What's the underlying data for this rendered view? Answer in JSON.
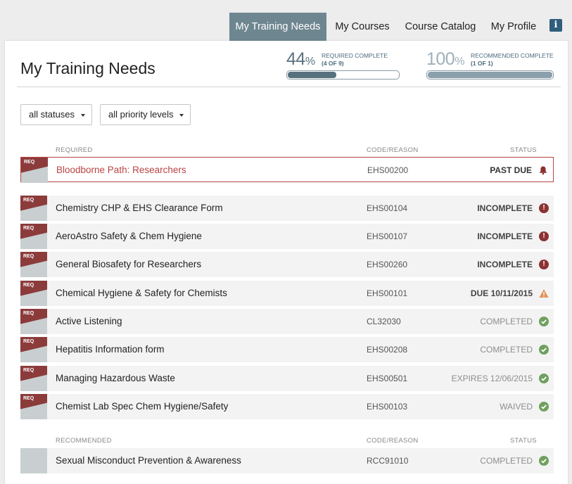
{
  "nav": {
    "tabs": [
      {
        "label": "My Training Needs",
        "active": true
      },
      {
        "label": "My Courses"
      },
      {
        "label": "Course Catalog"
      },
      {
        "label": "My Profile"
      }
    ],
    "info_icon": "info-icon"
  },
  "header": {
    "title": "My Training Needs",
    "required": {
      "pct": "44",
      "unit": "%",
      "label": "REQUIRED COMPLETE",
      "sub": "(4 OF 9)",
      "fill_fraction": 0.44
    },
    "recommended": {
      "pct": "100",
      "unit": "%",
      "label": "RECOMMENDED COMPLETE",
      "sub": "(1 OF 1)",
      "fill_fraction": 1.0
    }
  },
  "filters": {
    "status": "all statuses",
    "priority": "all priority levels"
  },
  "required_section": {
    "col_name": "REQUIRED",
    "col_code": "CODE/REASON",
    "col_status": "STATUS",
    "tag_text": "REQ",
    "rows": [
      {
        "name": "Bloodborne Path: Researchers",
        "code": "EHS00200",
        "status": "PAST DUE",
        "icon": "bell-icon"
      },
      {
        "name": "Chemistry CHP & EHS Clearance Form",
        "code": "EHS00104",
        "status": "INCOMPLETE",
        "icon": "exclamation-circle-icon"
      },
      {
        "name": "AeroAstro Safety & Chem Hygiene",
        "code": "EHS00107",
        "status": "INCOMPLETE",
        "icon": "exclamation-circle-icon"
      },
      {
        "name": "General Biosafety for Researchers",
        "code": "EHS00260",
        "status": "INCOMPLETE",
        "icon": "exclamation-circle-icon"
      },
      {
        "name": "Chemical Hygiene & Safety for Chemists",
        "code": "EHS00101",
        "status": "DUE 10/11/2015",
        "icon": "warning-triangle-icon"
      },
      {
        "name": "Active Listening",
        "code": "CL32030",
        "status": "COMPLETED",
        "icon": "check-circle-icon"
      },
      {
        "name": "Hepatitis Information form",
        "code": "EHS00208",
        "status": "COMPLETED",
        "icon": "check-circle-icon"
      },
      {
        "name": "Managing Hazardous Waste",
        "code": "EHS00501",
        "status": "EXPIRES 12/06/2015",
        "icon": "check-circle-icon"
      },
      {
        "name": "Chemist Lab Spec Chem Hygiene/Safety",
        "code": "EHS00103",
        "status": "WAIVED",
        "icon": "check-circle-icon"
      }
    ]
  },
  "recommended_section": {
    "col_name": "RECOMMENDED",
    "col_code": "CODE/REASON",
    "col_status": "STATUS",
    "rows": [
      {
        "name": "Sexual Misconduct Prevention & Awareness",
        "code": "RCC91010",
        "status": "COMPLETED",
        "icon": "check-circle-icon"
      }
    ]
  },
  "colors": {
    "accent": "#6e8690",
    "req_tag": "#8c3b3b",
    "past_due": "#b94343",
    "complete_green": "#6fa05e"
  }
}
